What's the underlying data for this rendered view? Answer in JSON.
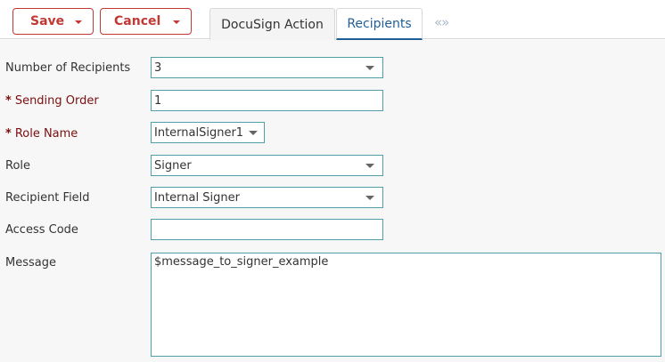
{
  "toolbar": {
    "save_label": "Save",
    "cancel_label": "Cancel",
    "accent_color": "#c23934"
  },
  "tabs": [
    {
      "label": "DocuSign Action",
      "active": false
    },
    {
      "label": "Recipients",
      "active": true
    }
  ],
  "tab_scroll_glyph": "«»",
  "form": {
    "number_of_recipients": {
      "label": "Number of Recipients",
      "value": "3",
      "required": false
    },
    "sending_order": {
      "label": "Sending Order",
      "value": "1",
      "required": true
    },
    "role_name": {
      "label": "Role Name",
      "value": "InternalSigner1",
      "required": true
    },
    "role": {
      "label": "Role",
      "value": "Signer",
      "required": false
    },
    "recipient_field": {
      "label": "Recipient Field",
      "value": "Internal Signer",
      "required": false
    },
    "access_code": {
      "label": "Access Code",
      "value": "",
      "required": false
    },
    "message": {
      "label": "Message",
      "value": "$message_to_signer_example",
      "required": false
    }
  },
  "required_marker": "*",
  "colors": {
    "field_border": "#4f9ea8",
    "required_label": "#7a0f0f",
    "active_tab": "#1f5e96"
  }
}
